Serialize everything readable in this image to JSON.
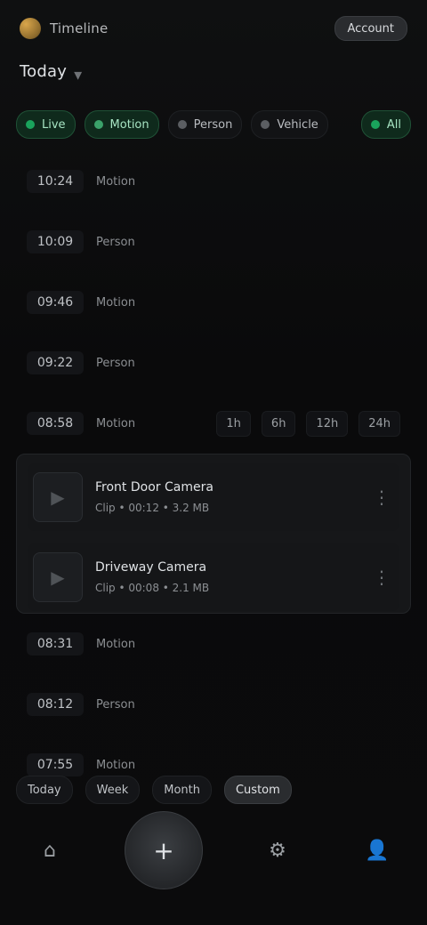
{
  "app": {
    "title": "Timeline",
    "top_action": "Account"
  },
  "header": {
    "subtitle": "Today"
  },
  "chips": [
    {
      "label": "Live",
      "state": "on",
      "color": "#1aa35c"
    },
    {
      "label": "Motion",
      "state": "on",
      "color": "#3ba16a"
    },
    {
      "label": "Person",
      "state": "off",
      "color": "#5b5e62"
    },
    {
      "label": "Vehicle",
      "state": "off",
      "color": "#5b5e62"
    },
    {
      "label": "All",
      "state": "on",
      "color": "#1aa35c"
    }
  ],
  "rows_top": [
    {
      "time": "10:24",
      "tag": "Motion"
    },
    {
      "time": "10:09",
      "tag": "Person"
    },
    {
      "time": "09:46",
      "tag": "Motion"
    },
    {
      "time": "09:22",
      "tag": "Person"
    },
    {
      "time": "08:58",
      "tag": "Motion",
      "summary": [
        "1h",
        "6h",
        "12h",
        "24h"
      ]
    }
  ],
  "expanded": [
    {
      "title": "Front Door Camera",
      "subtitle": "Clip • 00:12 • 3.2 MB"
    },
    {
      "title": "Driveway Camera",
      "subtitle": "Clip • 00:08 • 2.1 MB"
    }
  ],
  "rows_bottom": [
    {
      "time": "08:31",
      "tag": "Motion"
    },
    {
      "time": "08:12",
      "tag": "Person"
    },
    {
      "time": "07:55",
      "tag": "Motion"
    }
  ],
  "filters": [
    {
      "label": "Today",
      "active": false
    },
    {
      "label": "Week",
      "active": false
    },
    {
      "label": "Month",
      "active": false
    },
    {
      "label": "Custom",
      "active": true
    }
  ],
  "nav": [
    {
      "icon": "home-icon",
      "label": "Home"
    },
    {
      "icon": "plus-icon",
      "label": "Add"
    },
    {
      "icon": "gear-icon",
      "label": "Settings"
    },
    {
      "icon": "user-icon",
      "label": "Profile"
    }
  ]
}
